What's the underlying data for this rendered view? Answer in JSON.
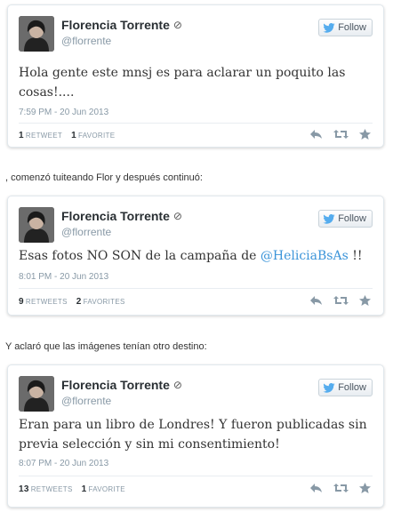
{
  "tweets": [
    {
      "author_name": "Florencia Torrente",
      "verified_icon": "circle-check-icon",
      "handle": "@florrente",
      "follow_label": "Follow",
      "text": "Hola gente este mnsj es para aclarar un poquito las cosas!....",
      "timestamp": "7:59 PM - 20 Jun 2013",
      "retweets_count": "1",
      "retweets_label": "RETWEET",
      "favorites_count": "1",
      "favorites_label": "FAVORITE"
    },
    {
      "author_name": "Florencia Torrente",
      "verified_icon": "circle-check-icon",
      "handle": "@florrente",
      "follow_label": "Follow",
      "text_before_mention": "Esas fotos NO SON de la campaña de ",
      "mention": "@HeliciaBsAs",
      "text_after_mention": " !!",
      "timestamp": "8:01 PM - 20 Jun 2013",
      "retweets_count": "9",
      "retweets_label": "RETWEETS",
      "favorites_count": "2",
      "favorites_label": "FAVORITES"
    },
    {
      "author_name": "Florencia Torrente",
      "verified_icon": "circle-check-icon",
      "handle": "@florrente",
      "follow_label": "Follow",
      "text": "Eran para un libro de Londres! Y fueron publicadas sin previa selección y sin  mi consentimiento!",
      "timestamp": "8:07 PM - 20 Jun 2013",
      "retweets_count": "13",
      "retweets_label": "RETWEETS",
      "favorites_count": "1",
      "favorites_label": "FAVORITE"
    }
  ],
  "captions": [
    ", comenzó tuiteando Flor y después continuó:",
    "Y aclaró que las imágenes tenían otro destino:"
  ],
  "icons": {
    "follow": "twitter-bird-icon",
    "reply": "reply-icon",
    "retweet": "retweet-icon",
    "favorite": "star-icon"
  },
  "colors": {
    "link": "#3b94d9",
    "muted": "#8899a6",
    "bird": "#55acee"
  }
}
